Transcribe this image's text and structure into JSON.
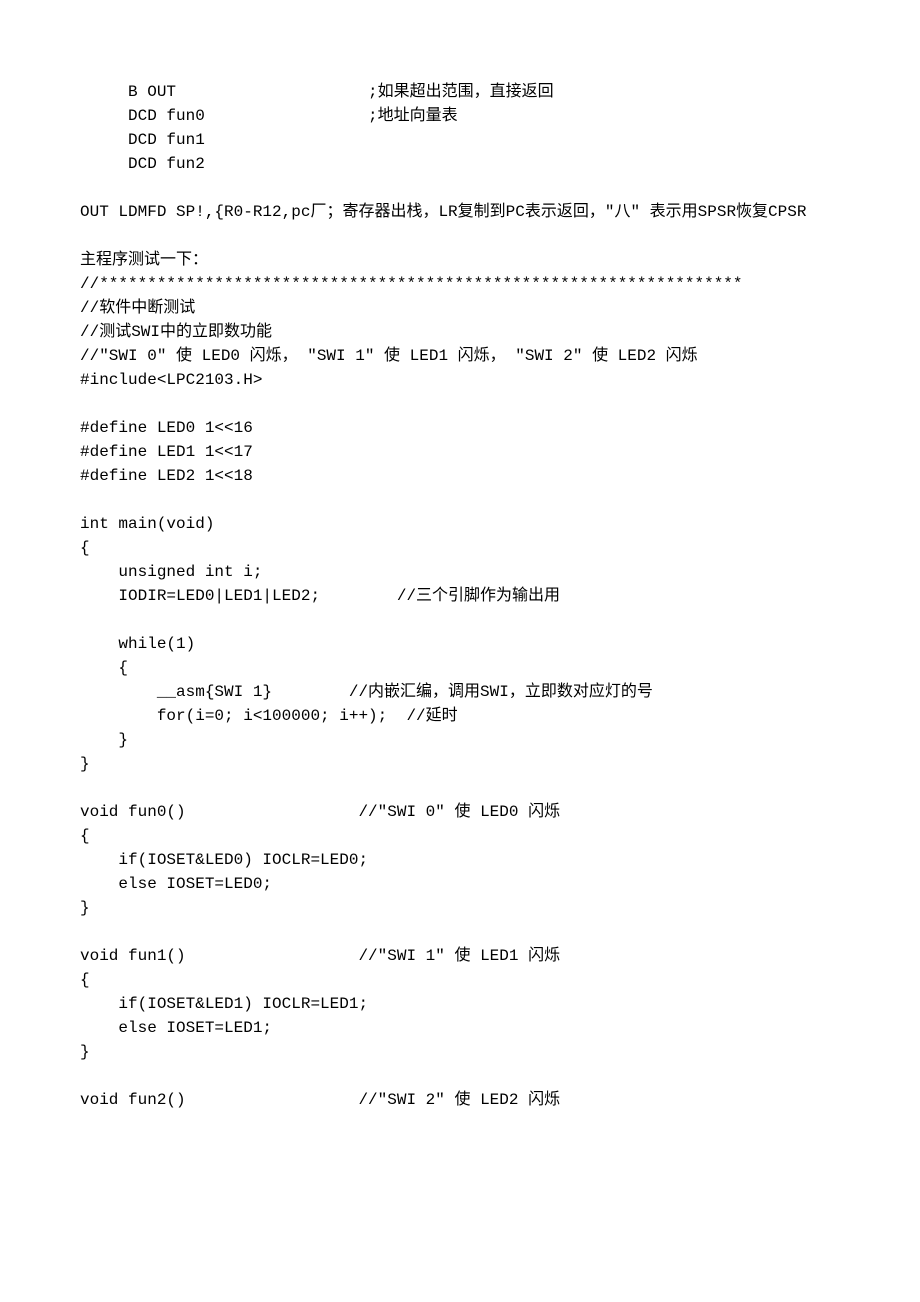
{
  "lines": [
    "     B OUT                    ;如果超出范围，直接返回",
    "     DCD fun0                 ;地址向量表",
    "     DCD fun1",
    "     DCD fun2",
    "",
    "OUT LDMFD SP!,{R0-R12,pc厂；寄存器出栈，LR复制到PC表示返回，\"八\" 表示用SPSR恢复CPSR",
    "",
    "主程序测试一下：",
    "//*******************************************************************",
    "//软件中断测试",
    "//测试SWI中的立即数功能",
    "//\"SWI 0\" 使 LED0 闪烁， \"SWI 1\" 使 LED1 闪烁， \"SWI 2\" 使 LED2 闪烁",
    "#include<LPC2103.H>",
    "",
    "#define LED0 1<<16",
    "#define LED1 1<<17",
    "#define LED2 1<<18",
    "",
    "int main(void)",
    "{",
    "    unsigned int i;",
    "    IODIR=LED0|LED1|LED2;        //三个引脚作为输出用",
    "",
    "    while(1)",
    "    {",
    "        __asm{SWI 1}        //内嵌汇编，调用SWI，立即数对应灯的号",
    "        for(i=0; i<100000; i++);  //延时",
    "    }",
    "}",
    "",
    "void fun0()                  //\"SWI 0\" 使 LED0 闪烁",
    "{",
    "    if(IOSET&LED0) IOCLR=LED0;",
    "    else IOSET=LED0;",
    "}",
    "",
    "void fun1()                  //\"SWI 1\" 使 LED1 闪烁",
    "{",
    "    if(IOSET&LED1) IOCLR=LED1;",
    "    else IOSET=LED1;",
    "}",
    "",
    "void fun2()                  //\"SWI 2\" 使 LED2 闪烁"
  ]
}
